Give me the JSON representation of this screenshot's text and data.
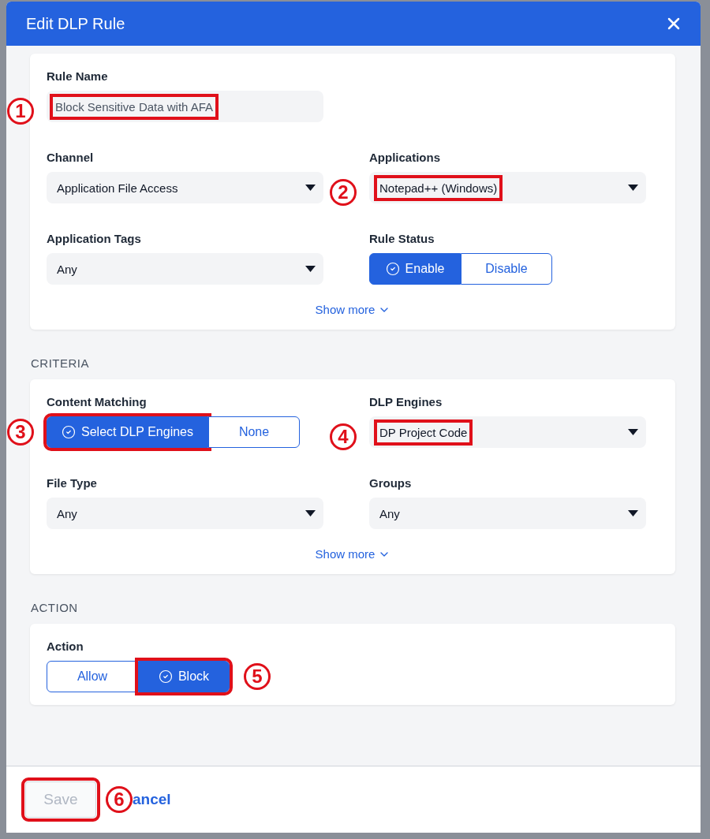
{
  "dialog": {
    "title": "Edit DLP Rule"
  },
  "sections": [
    {
      "rows": [
        [
          {
            "kind": "text",
            "label": "Rule Name",
            "value": "Block Sensitive Data with AFA",
            "callout": "1"
          }
        ],
        [
          {
            "kind": "select",
            "label": "Channel",
            "value": "Application File Access"
          },
          {
            "kind": "select",
            "label": "Applications",
            "value": "Notepad++ (Windows)",
            "callout": "2"
          }
        ],
        [
          {
            "kind": "select",
            "label": "Application Tags",
            "value": "Any"
          },
          {
            "kind": "toggle",
            "label": "Rule Status",
            "options": [
              {
                "label": "Enable",
                "selected": true
              },
              {
                "label": "Disable",
                "selected": false
              }
            ]
          }
        ]
      ],
      "show_more": "Show more"
    },
    {
      "heading": "CRITERIA",
      "rows": [
        [
          {
            "kind": "toggle",
            "label": "Content Matching",
            "options": [
              {
                "label": "Select DLP Engines",
                "selected": true,
                "callout": "3"
              },
              {
                "label": "None",
                "selected": false
              }
            ]
          },
          {
            "kind": "select",
            "label": "DLP Engines",
            "value": "DP Project Code",
            "callout": "4"
          }
        ],
        [
          {
            "kind": "select",
            "label": "File Type",
            "value": "Any"
          },
          {
            "kind": "select",
            "label": "Groups",
            "value": "Any"
          }
        ]
      ],
      "show_more": "Show more"
    },
    {
      "heading": "ACTION",
      "rows": [
        [
          {
            "kind": "toggle",
            "label": "Action",
            "options": [
              {
                "label": "Allow",
                "selected": false
              },
              {
                "label": "Block",
                "selected": true,
                "callout": "5"
              }
            ]
          }
        ]
      ]
    }
  ],
  "footer": {
    "save": {
      "label": "Save",
      "disabled": true,
      "callout": "6"
    },
    "cancel": "ancel"
  }
}
